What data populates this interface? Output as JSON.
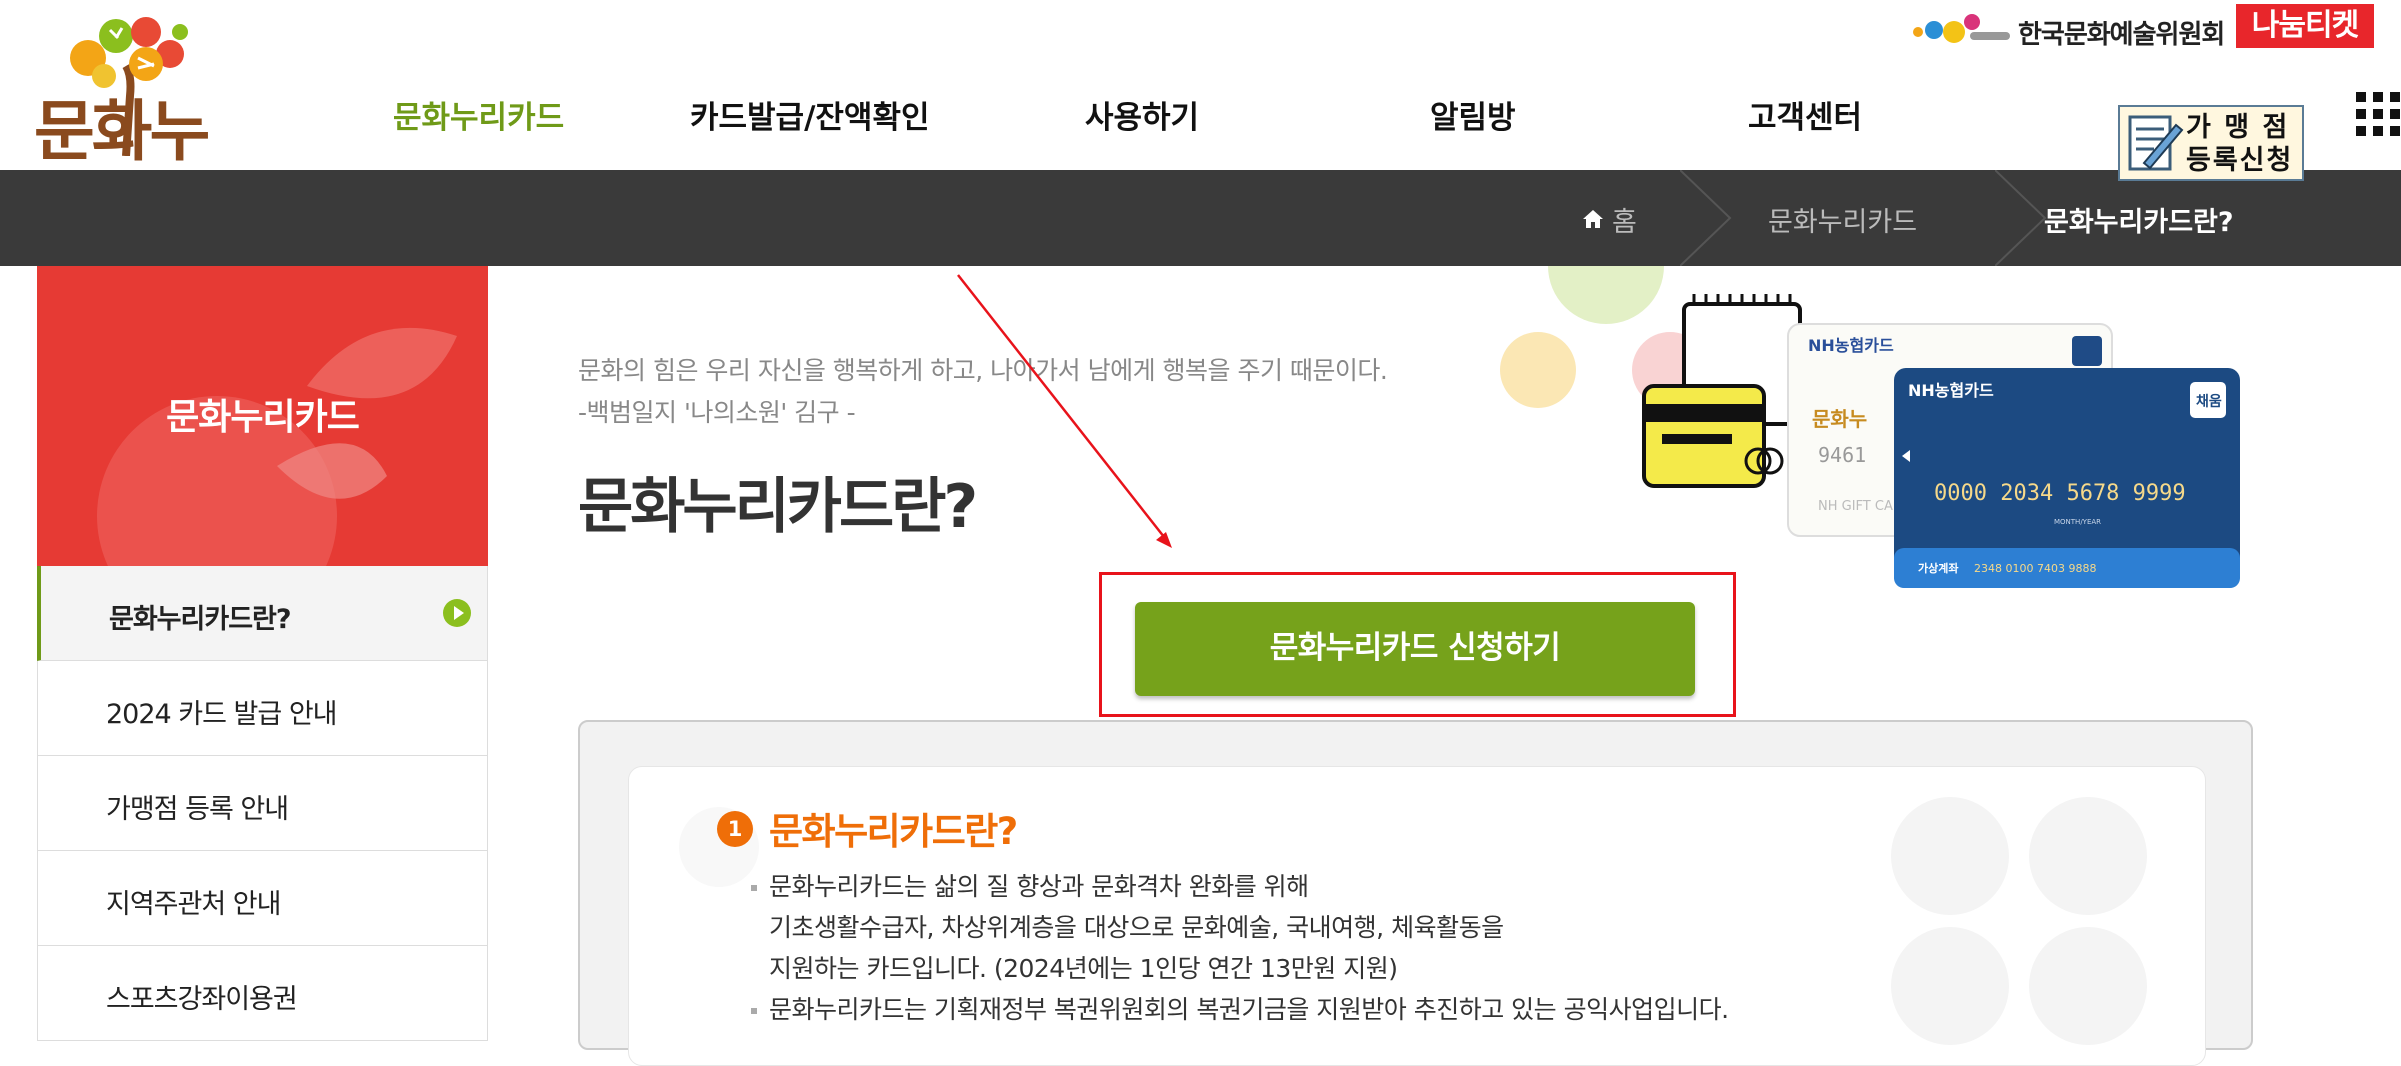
{
  "header": {
    "logo_text": "문화누리",
    "org_name": "한국문화예술위원회",
    "nanum_ticket": "나눔티켓",
    "merchant_button": "가 맹 점\n등록신청"
  },
  "gnb": {
    "items": [
      {
        "label": "문화누리카드",
        "active": true
      },
      {
        "label": "카드발급/잔액확인",
        "active": false
      },
      {
        "label": "사용하기",
        "active": false
      },
      {
        "label": "알림방",
        "active": false
      },
      {
        "label": "고객센터",
        "active": false
      }
    ]
  },
  "breadcrumb": {
    "home": "홈",
    "level1": "문화누리카드",
    "current": "문화누리카드란?"
  },
  "lnb": {
    "title": "문화누리카드",
    "items": [
      {
        "label": "문화누리카드란?",
        "active": true
      },
      {
        "label": "2024 카드 발급 안내",
        "active": false
      },
      {
        "label": "가맹점 등록 안내",
        "active": false
      },
      {
        "label": "지역주관처 안내",
        "active": false
      },
      {
        "label": "스포츠강좌이용권",
        "active": false
      }
    ]
  },
  "main": {
    "quote": "문화의 힘은 우리 자신을 행복하게 하고, 나아가서 남에게 행복을 주기 때문이다.\n-백범일지 '나의소원' 김구 -",
    "page_title": "문화누리카드란?",
    "apply_button": "문화누리카드 신청하기",
    "section": {
      "number": "1",
      "title": "문화누리카드란?",
      "lines": [
        "문화누리카드는 삶의 질 향상과 문화격차 완화를 위해",
        "기초생활수급자, 차상위계층을 대상으로 문화예술, 국내여행, 체육활동을",
        "지원하는 카드입니다. (2024년에는 1인당 연간 13만원 지원)",
        "문화누리카드는 기획재정부 복권위원회의 복권기금을 지원받아 추진하고 있는 공익사업입니다."
      ]
    }
  },
  "cards": {
    "brand": "NH농협카드",
    "badge": "채움",
    "number": "0000 2034 5678 9999",
    "valid": "MONTH/YEAR",
    "account_label": "가상계좌",
    "account_number": "2348 0100 7403 9888",
    "back_card_brand": "NH GIFT CA",
    "back_card_number": "9461",
    "back_card_logo": "문화누"
  },
  "annotation": {
    "color": "#e8131b"
  },
  "colors": {
    "accent_green": "#76a21b",
    "lnb_red": "#e63a34",
    "bar_dark": "#3a3a3a",
    "section_orange": "#ef6e08"
  }
}
